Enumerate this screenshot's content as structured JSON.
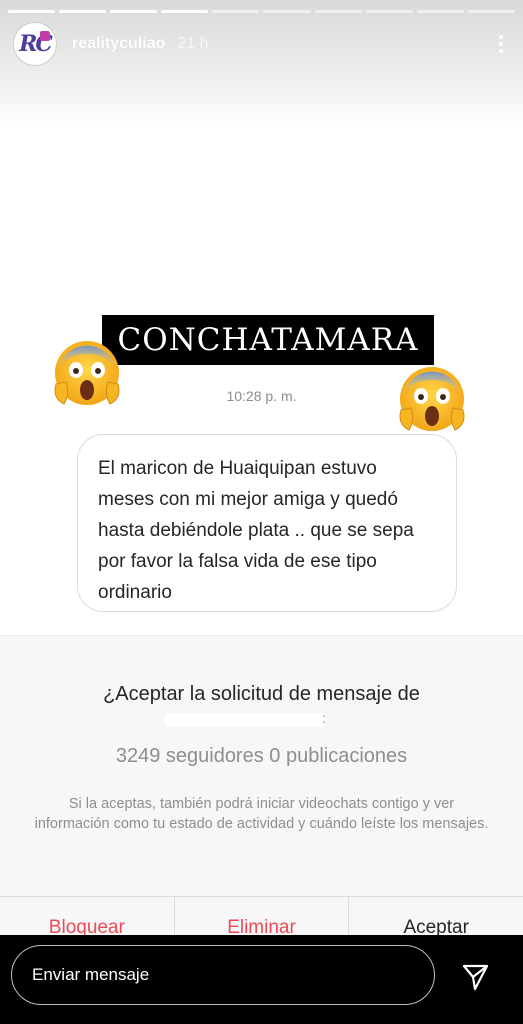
{
  "story": {
    "username": "realityculiao",
    "time_ago": "21 h",
    "avatar_text": "RC",
    "progress_segments": 10,
    "progress_done": 4,
    "headline": "CONCHATAMARA",
    "message_time": "10:28 p. m.",
    "message_text": "El maricon de Huaiquipan estuvo meses con mi mejor amiga y quedó hasta debiéndole plata .. que se sepa por favor la falsa vida de ese tipo ordinario",
    "emoji_icon": "screaming-face-emoji"
  },
  "request": {
    "title": "¿Aceptar la solicitud de mensaje de",
    "colon": ":",
    "stats": "3249 seguidores 0 publicaciones",
    "note": "Si la aceptas, también podrá iniciar videochats contigo y ver información como tu estado de actividad y cuándo leíste los mensajes.",
    "actions": [
      {
        "label": "Bloquear"
      },
      {
        "label": "Eliminar"
      },
      {
        "label": "Aceptar"
      }
    ]
  },
  "reply": {
    "placeholder": "Enviar mensaje",
    "send_icon": "send-icon"
  },
  "colors": {
    "destructive": "#ed4956",
    "text": "#262626",
    "muted": "#8e8e8e"
  }
}
